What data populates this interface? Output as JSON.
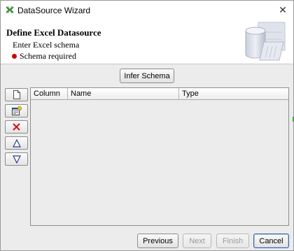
{
  "window": {
    "title": "DataSource Wizard",
    "close_glyph": "✕"
  },
  "header": {
    "title": "Define Excel Datasource",
    "subtitle": "Enter Excel schema",
    "status": "Schema required",
    "status_color": "#cc0000"
  },
  "toolbar": {
    "infer_schema_label": "Infer Schema",
    "tools": [
      {
        "name": "new-row-icon"
      },
      {
        "name": "properties-icon"
      },
      {
        "name": "delete-icon"
      },
      {
        "name": "move-up-icon"
      },
      {
        "name": "move-down-icon"
      }
    ]
  },
  "table": {
    "columns": [
      "Column",
      "Name",
      "Type"
    ],
    "rows": []
  },
  "footer": {
    "previous_label": "Previous",
    "next_label": "Next",
    "finish_label": "Finish",
    "cancel_label": "Cancel"
  }
}
